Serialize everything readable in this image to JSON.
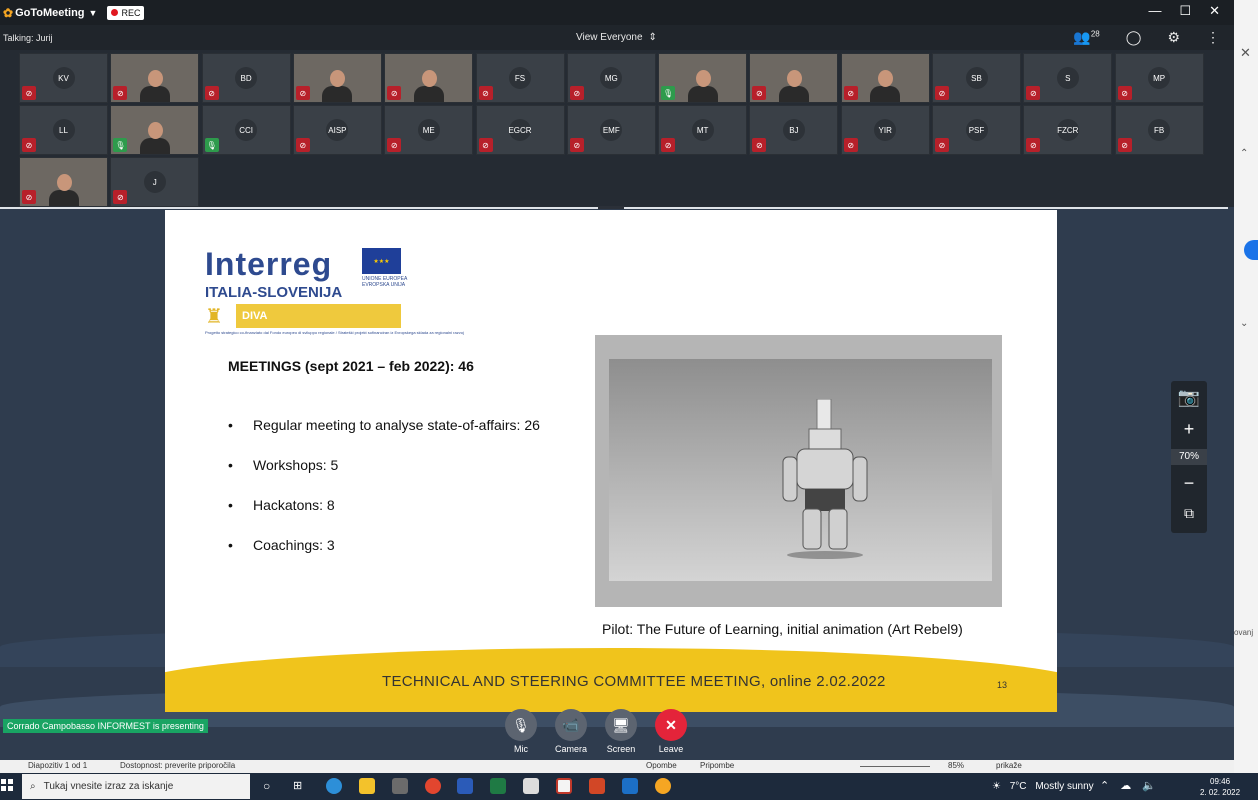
{
  "titlebar": {
    "app": "GoToMeeting",
    "rec": "REC",
    "min": "—",
    "max": "☐",
    "close": "✕"
  },
  "infobar": {
    "talking": "Talking: Jurij",
    "view": "View Everyone",
    "attendees": "28"
  },
  "participants": [
    {
      "initials": "KV",
      "video": false,
      "mic": "muted"
    },
    {
      "initials": "",
      "video": true,
      "mic": "muted"
    },
    {
      "initials": "BD",
      "video": false,
      "mic": "muted"
    },
    {
      "initials": "",
      "video": true,
      "mic": "muted"
    },
    {
      "initials": "",
      "video": true,
      "mic": "muted"
    },
    {
      "initials": "FS",
      "video": false,
      "mic": "muted"
    },
    {
      "initials": "MG",
      "video": false,
      "mic": "muted"
    },
    {
      "initials": "",
      "video": true,
      "mic": "on"
    },
    {
      "initials": "",
      "video": true,
      "mic": "muted"
    },
    {
      "initials": "",
      "video": true,
      "mic": "muted"
    },
    {
      "initials": "SB",
      "video": false,
      "mic": "muted"
    },
    {
      "initials": "S",
      "video": false,
      "mic": "muted"
    },
    {
      "initials": "MP",
      "video": false,
      "mic": "muted"
    },
    {
      "initials": "LL",
      "video": false,
      "mic": "muted"
    },
    {
      "initials": "",
      "video": true,
      "mic": "on"
    },
    {
      "initials": "CCI",
      "video": false,
      "mic": "on"
    },
    {
      "initials": "AISP",
      "video": false,
      "mic": "muted"
    },
    {
      "initials": "ME",
      "video": false,
      "mic": "muted"
    },
    {
      "initials": "EGCR",
      "video": false,
      "mic": "muted"
    },
    {
      "initials": "EMF",
      "video": false,
      "mic": "muted"
    },
    {
      "initials": "MT",
      "video": false,
      "mic": "muted"
    },
    {
      "initials": "BJ",
      "video": false,
      "mic": "muted"
    },
    {
      "initials": "YIR",
      "video": false,
      "mic": "muted"
    },
    {
      "initials": "PSF",
      "video": false,
      "mic": "muted"
    },
    {
      "initials": "FZCR",
      "video": false,
      "mic": "muted"
    },
    {
      "initials": "FB",
      "video": false,
      "mic": "muted"
    },
    {
      "initials": "",
      "video": true,
      "mic": "muted"
    },
    {
      "initials": "J",
      "video": false,
      "mic": "muted"
    }
  ],
  "slide": {
    "logo_main": "Interreg",
    "logo_sub": "ITALIA-SLOVENIJA",
    "eu_text": "UNIONE EUROPEA EVROPSKA UNIJA",
    "diva": "DIVA",
    "project_note": "Progetto strategico co-finanziato dal Fondo europeo di sviluppo regionale / Strateški projekt sofinanciran iz Evropskega sklada za regionalni razvoj",
    "heading": "MEETINGS (sept 2021 – feb 2022): 46",
    "bullets": [
      "Regular meeting to analyse state-of-affairs: 26",
      "Workshops: 5",
      "Hackatons: 8",
      "Coachings: 3"
    ],
    "caption": "Pilot: The Future of Learning, initial animation (Art Rebel9)",
    "footer": "TECHNICAL AND STEERING COMMITTEE MEETING, online 2.02.2022",
    "page": "13"
  },
  "zoom": {
    "level": "70%"
  },
  "presenting": "Corrado Campobasso INFORMEST is presenting",
  "controls": {
    "mic": "Mic",
    "camera": "Camera",
    "screen": "Screen",
    "leave": "Leave"
  },
  "ppt": {
    "slide_count": "Diapozitiv 1 od 1",
    "accessibility": "Dostopnost: preverite priporočila",
    "notes": "Opombe",
    "comments": "Pripombe",
    "zoom": "85%"
  },
  "taskbar": {
    "search": "Tukaj vnesite izraz za iskanje",
    "temp": "7°C",
    "weather": "Mostly sunny",
    "time": "09:46",
    "date": "2. 02. 2022"
  },
  "side": {
    "word1": "ovanj",
    "word2": "prikaže"
  }
}
